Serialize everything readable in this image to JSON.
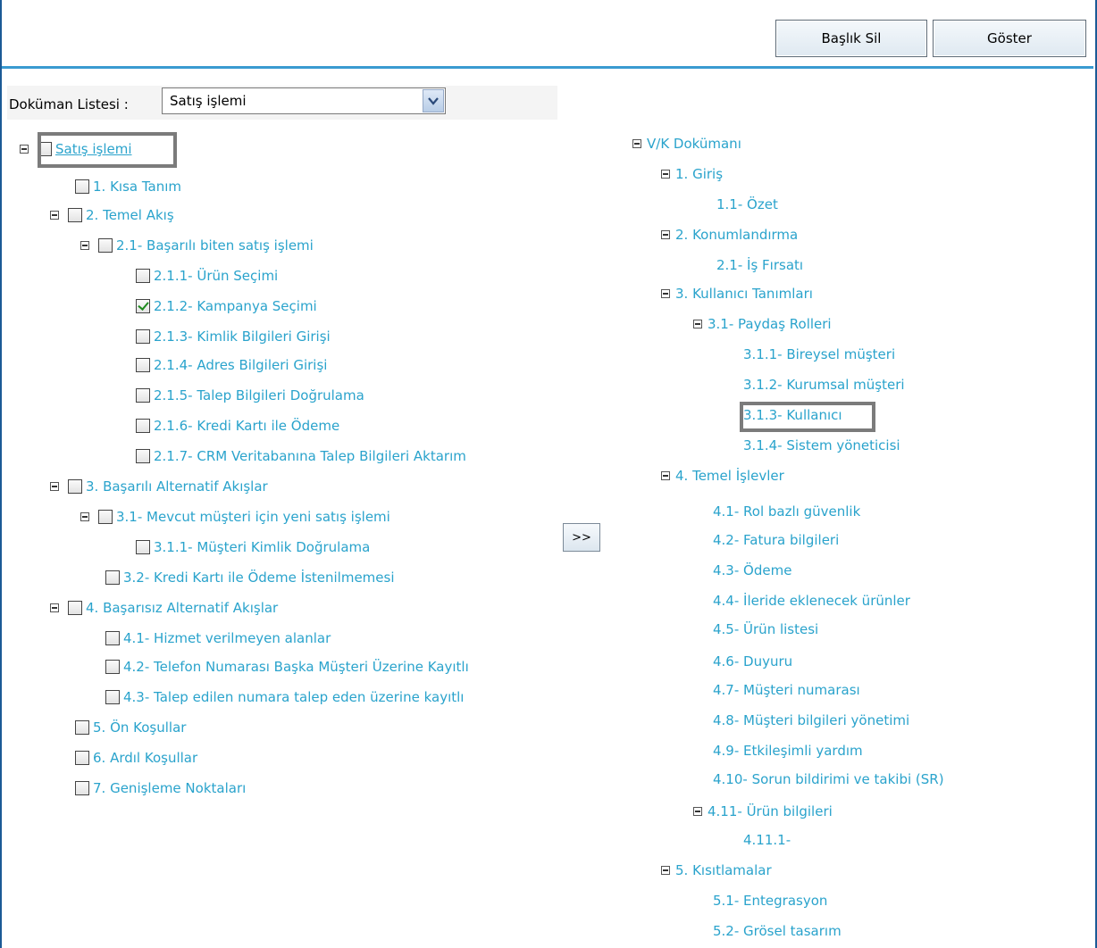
{
  "toolbar": {
    "delete_heading_label": "Başlık Sil",
    "show_label": "Göster"
  },
  "doc_list": {
    "label": "Doküman Listesi :",
    "selected": "Satış işlemi"
  },
  "move_button_label": ">>",
  "left_tree": [
    {
      "label": "Satış işlemi",
      "checked": false,
      "expander": true
    },
    {
      "label": "1. Kısa Tanım",
      "checked": false,
      "expander": false
    },
    {
      "label": "2. Temel Akış",
      "checked": false,
      "expander": true
    },
    {
      "label": "2.1- Başarılı biten satış işlemi",
      "checked": false,
      "expander": true
    },
    {
      "label": "2.1.1- Ürün Seçimi",
      "checked": false,
      "expander": false
    },
    {
      "label": "2.1.2- Kampanya Seçimi",
      "checked": true,
      "expander": false
    },
    {
      "label": "2.1.3- Kimlik Bilgileri Girişi",
      "checked": false,
      "expander": false
    },
    {
      "label": "2.1.4- Adres Bilgileri Girişi",
      "checked": false,
      "expander": false
    },
    {
      "label": "2.1.5- Talep Bilgileri Doğrulama",
      "checked": false,
      "expander": false
    },
    {
      "label": "2.1.6- Kredi Kartı ile Ödeme",
      "checked": false,
      "expander": false
    },
    {
      "label": "2.1.7- CRM Veritabanına Talep Bilgileri Aktarım",
      "checked": false,
      "expander": false
    },
    {
      "label": "3. Başarılı Alternatif Akışlar",
      "checked": false,
      "expander": true
    },
    {
      "label": "3.1- Mevcut müşteri için yeni satış işlemi",
      "checked": false,
      "expander": true
    },
    {
      "label": "3.1.1- Müşteri Kimlik Doğrulama",
      "checked": false,
      "expander": false
    },
    {
      "label": "3.2- Kredi Kartı ile Ödeme İstenilmemesi",
      "checked": false,
      "expander": false
    },
    {
      "label": "4. Başarısız Alternatif Akışlar",
      "checked": false,
      "expander": true
    },
    {
      "label": "4.1- Hizmet verilmeyen alanlar",
      "checked": false,
      "expander": false
    },
    {
      "label": "4.2- Telefon Numarası Başka Müşteri Üzerine Kayıtlı",
      "checked": false,
      "expander": false
    },
    {
      "label": "4.3- Talep edilen numara talep eden üzerine kayıtlı",
      "checked": false,
      "expander": false
    },
    {
      "label": "5. Ön Koşullar",
      "checked": false,
      "expander": false
    },
    {
      "label": "6. Ardıl Koşullar",
      "checked": false,
      "expander": false
    },
    {
      "label": "7. Genişleme Noktaları",
      "checked": false,
      "expander": false
    }
  ],
  "right_tree": [
    {
      "label": "V/K Dokümanı",
      "expander": true
    },
    {
      "label": "1. Giriş",
      "expander": true
    },
    {
      "label": "1.1- Özet",
      "expander": false
    },
    {
      "label": "2. Konumlandırma",
      "expander": true
    },
    {
      "label": "2.1- İş Fırsatı",
      "expander": false
    },
    {
      "label": "3. Kullanıcı Tanımları",
      "expander": true
    },
    {
      "label": "3.1- Paydaş Rolleri",
      "expander": true
    },
    {
      "label": "3.1.1- Bireysel müşteri",
      "expander": false
    },
    {
      "label": "3.1.2- Kurumsal müşteri",
      "expander": false
    },
    {
      "label": "3.1.3- Kullanıcı",
      "expander": false
    },
    {
      "label": "3.1.4- Sistem yöneticisi",
      "expander": false
    },
    {
      "label": "4. Temel İşlevler",
      "expander": true
    },
    {
      "label": "4.1- Rol bazlı güvenlik",
      "expander": false
    },
    {
      "label": "4.2- Fatura bilgileri",
      "expander": false
    },
    {
      "label": "4.3- Ödeme",
      "expander": false
    },
    {
      "label": "4.4- İleride eklenecek ürünler",
      "expander": false
    },
    {
      "label": "4.5- Ürün listesi",
      "expander": false
    },
    {
      "label": "4.6- Duyuru",
      "expander": false
    },
    {
      "label": "4.7- Müşteri numarası",
      "expander": false
    },
    {
      "label": "4.8- Müşteri bilgileri yönetimi",
      "expander": false
    },
    {
      "label": "4.9- Etkileşimli yardım",
      "expander": false
    },
    {
      "label": "4.10- Sorun bildirimi ve takibi (SR)",
      "expander": false
    },
    {
      "label": "4.11- Ürün bilgileri",
      "expander": true
    },
    {
      "label": "4.11.1-",
      "expander": false
    },
    {
      "label": "5. Kısıtlamalar",
      "expander": true
    },
    {
      "label": "5.1- Entegrasyon",
      "expander": false
    },
    {
      "label": "5.2- Grösel tasarım",
      "expander": false
    }
  ]
}
